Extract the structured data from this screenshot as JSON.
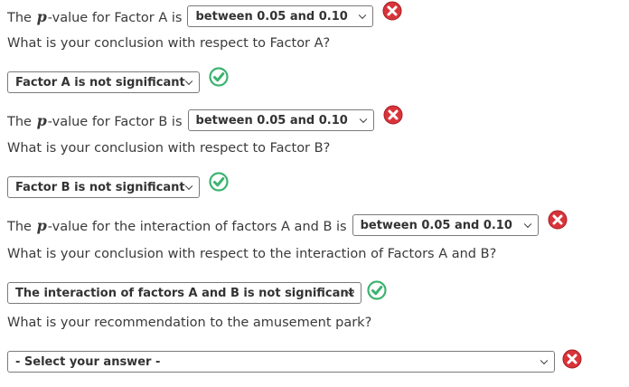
{
  "q1": {
    "prefix": "The",
    "pvar": "p",
    "suffix": "-value for Factor A is",
    "answer": "between 0.05 and 0.10",
    "status": "incorrect"
  },
  "q2": {
    "question": "What is your conclusion with respect to Factor A?",
    "answer": "Factor A is not significant",
    "status": "correct"
  },
  "q3": {
    "prefix": "The",
    "pvar": "p",
    "suffix": "-value for Factor B is",
    "answer": "between 0.05 and 0.10",
    "status": "incorrect"
  },
  "q4": {
    "question": "What is your conclusion with respect to Factor B?",
    "answer": "Factor B is not significant",
    "status": "correct"
  },
  "q5": {
    "prefix": "The",
    "pvar": "p",
    "suffix": "-value for the interaction of factors A and B is",
    "answer": "between 0.05 and 0.10",
    "status": "incorrect"
  },
  "q6": {
    "question": "What is your conclusion with respect to the interaction of Factors A and B?",
    "answer": "The interaction of factors A and B is not significant",
    "status": "correct"
  },
  "q7": {
    "question": "What is your recommendation to the amusement park?",
    "answer": "- Select your answer -",
    "status": "incorrect"
  },
  "colors": {
    "correct": "#3cb371",
    "incorrect": "#d9343a"
  }
}
